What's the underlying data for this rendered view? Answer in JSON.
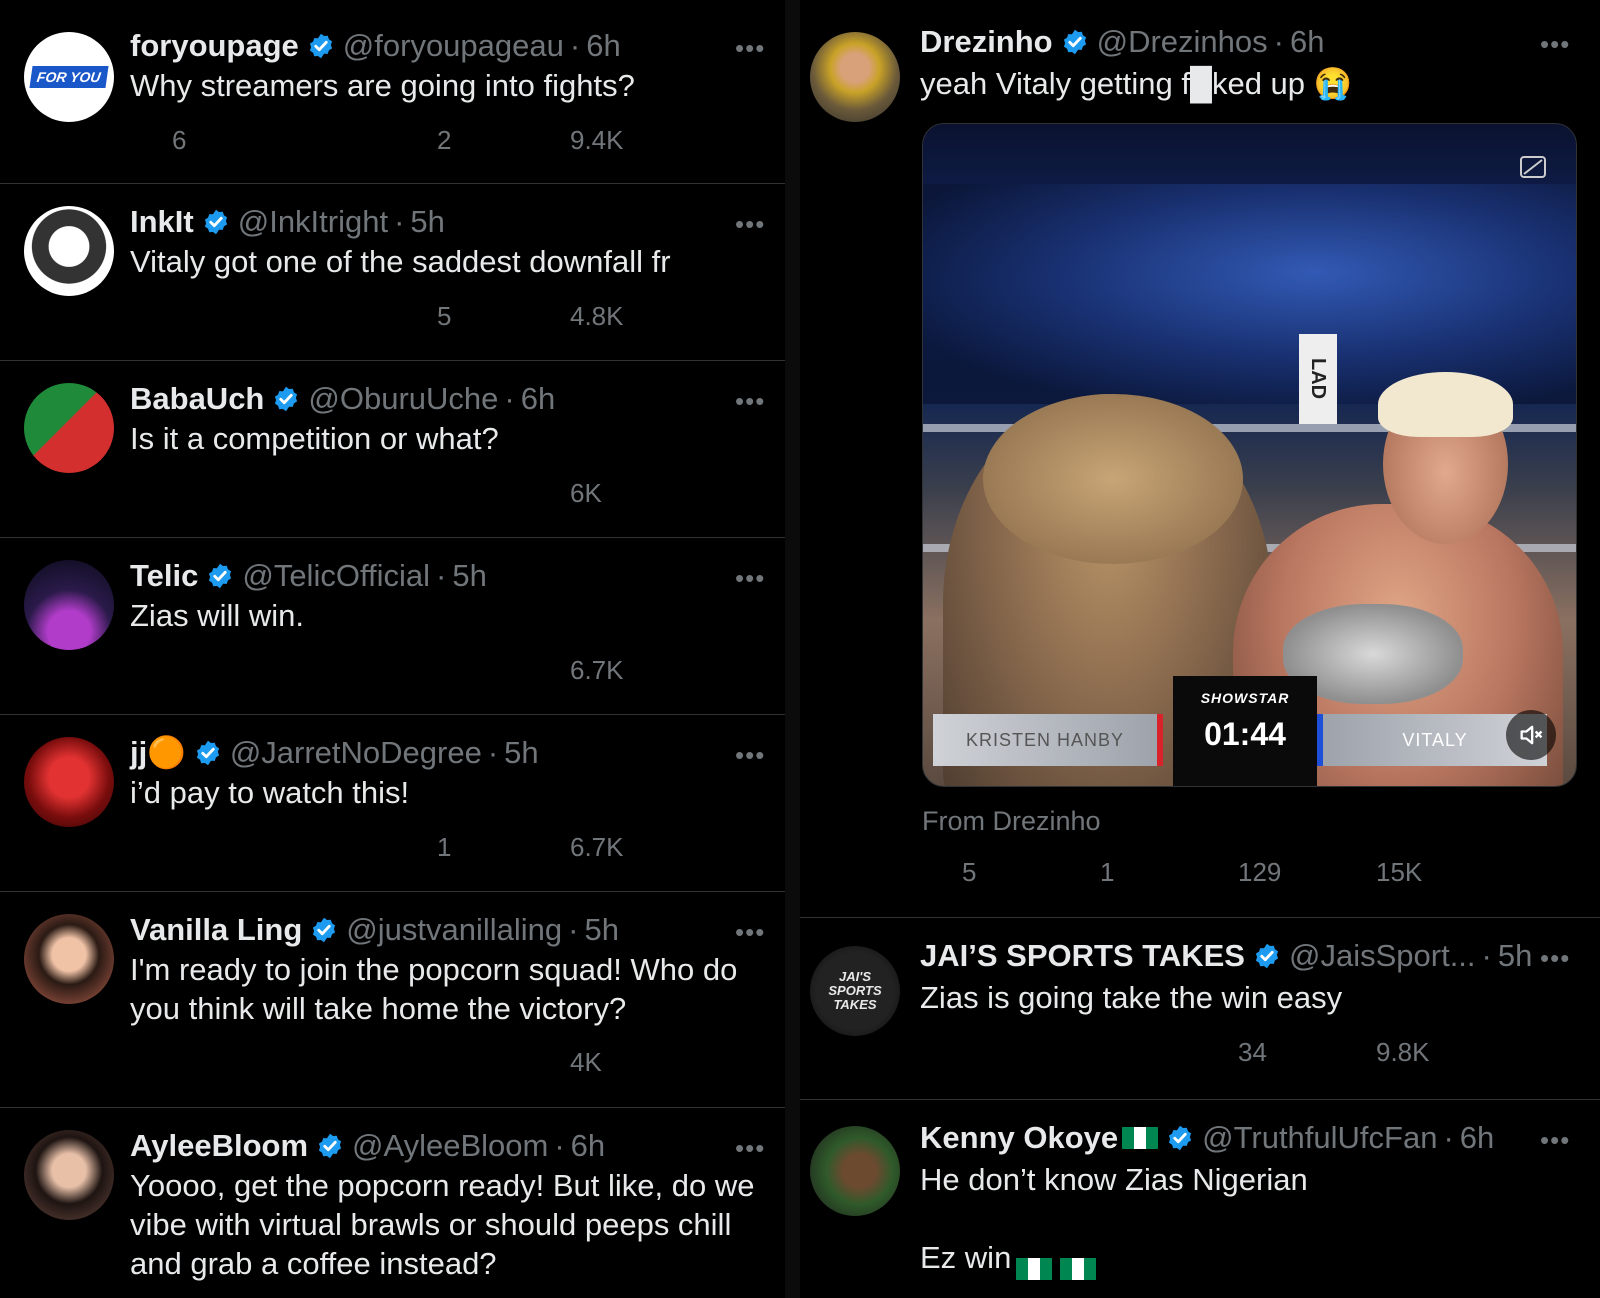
{
  "colors": {
    "background": "#000000",
    "text": "#e7e9ea",
    "muted": "#71767b",
    "verified": "#1d9bf0",
    "divider": "#2f3336"
  },
  "left_tweets": [
    {
      "name": "foryoupage",
      "handle": "@foryoupageau",
      "time": "6h",
      "text": "Why streamers are going into fights?",
      "replies": "6",
      "reposts": "",
      "likes": "2",
      "views": "9.4K",
      "avatar_text": "FOR YOU"
    },
    {
      "name": "InkIt",
      "handle": "@InkItright",
      "time": "5h",
      "text": "Vitaly got one of the saddest downfall fr",
      "replies": "",
      "reposts": "",
      "likes": "5",
      "views": "4.8K"
    },
    {
      "name": "BabaUch",
      "handle": "@OburuUche",
      "time": "6h",
      "text": "Is it a competition or what?",
      "replies": "",
      "reposts": "",
      "likes": "",
      "views": "6K"
    },
    {
      "name": "Telic",
      "handle": "@TelicOfficial",
      "time": "5h",
      "text": "Zias will win.",
      "replies": "",
      "reposts": "",
      "likes": "",
      "views": "6.7K"
    },
    {
      "name": "jj🟠",
      "handle": "@JarretNoDegree",
      "time": "5h",
      "text": "i’d pay to watch this!",
      "replies": "",
      "reposts": "",
      "likes": "1",
      "views": "6.7K"
    },
    {
      "name": "Vanilla Ling",
      "handle": "@justvanillaling",
      "time": "5h",
      "text": "I'm ready to join the popcorn squad! Who do\nyou think will take home the victory?",
      "replies": "",
      "reposts": "",
      "likes": "",
      "views": "4K"
    },
    {
      "name": "AyleeBloom",
      "handle": "@AyleeBloom",
      "time": "6h",
      "text": "Yoooo, get the popcorn ready! But like, do we\nvibe with virtual brawls or should peeps chill\nand grab a coffee instead?"
    }
  ],
  "right_tweets": [
    {
      "name": "Drezinho",
      "handle": "@Drezinhos",
      "time": "6h",
      "text": "yeah Vitaly getting f█ked up 😭",
      "replies": "5",
      "reposts": "1",
      "likes": "129",
      "views": "15K",
      "from": "From Drezinho",
      "video": {
        "scoreboard_left": "KRISTEN HANBY",
        "scoreboard_brand": "SHOWSTAR",
        "scoreboard_clock": "01:44",
        "scoreboard_right": "VITALY",
        "corner_post": "LAD"
      }
    },
    {
      "name": "JAI’S SPORTS TAKES",
      "handle": "@JaisSport...",
      "time": "5h",
      "text": "Zias is going take the win easy",
      "replies": "",
      "reposts": "",
      "likes": "34",
      "views": "9.8K",
      "avatar_text": "JAI'S SPORTS TAKES"
    },
    {
      "name": "Kenny Okoye",
      "handle": "@TruthfulUfcFan",
      "time": "6h",
      "text": "He don’t know Zias Nigerian\n\nEz win"
    }
  ],
  "icons": [
    "reply-icon",
    "repost-icon",
    "like-icon",
    "views-icon",
    "bookmark-icon",
    "share-icon",
    "verified-icon",
    "more-icon",
    "mute-icon",
    "captions-icon"
  ]
}
